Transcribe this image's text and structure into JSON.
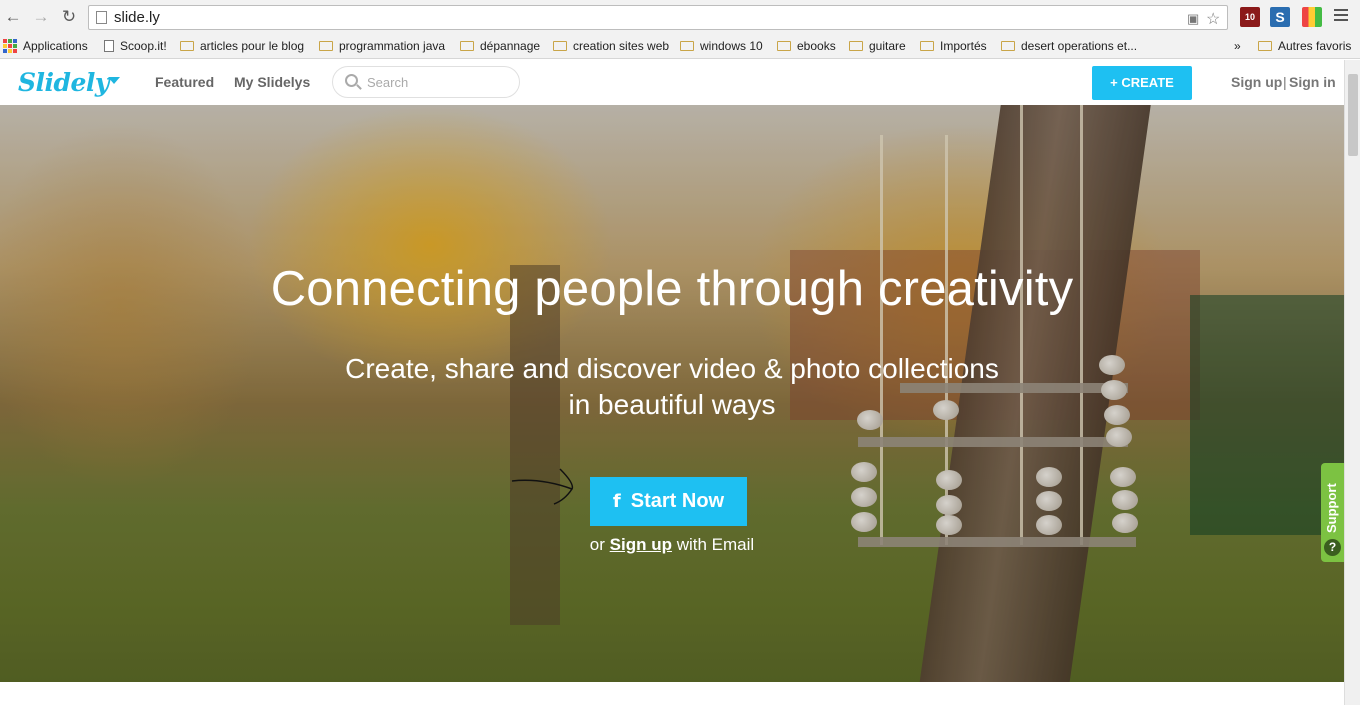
{
  "browser": {
    "url": "slide.ly",
    "bookmarks": [
      {
        "label": "Applications",
        "icon": "apps-grid-icon"
      },
      {
        "label": "Scoop.it!",
        "icon": "doc-icon"
      },
      {
        "label": "articles pour le blog",
        "icon": "folder-icon"
      },
      {
        "label": "programmation java",
        "icon": "folder-icon"
      },
      {
        "label": "dépannage",
        "icon": "folder-icon"
      },
      {
        "label": "creation sites web",
        "icon": "folder-icon"
      },
      {
        "label": "windows 10",
        "icon": "folder-icon"
      },
      {
        "label": "ebooks",
        "icon": "folder-icon"
      },
      {
        "label": "guitare",
        "icon": "folder-icon"
      },
      {
        "label": "Importés",
        "icon": "folder-icon"
      },
      {
        "label": "desert operations et...",
        "icon": "folder-icon"
      }
    ],
    "overflow_label": "»",
    "other_bookmarks": "Autres favoris",
    "ublock_count": "10"
  },
  "header": {
    "logo": "Slidely",
    "nav": {
      "featured": "Featured",
      "my_slidelys": "My Slidelys"
    },
    "search_placeholder": "Search",
    "create_label": "+ CREATE",
    "sign_up": "Sign up",
    "separator": "|",
    "sign_in": "Sign in"
  },
  "hero": {
    "headline": "Connecting people through creativity",
    "subline_1": "Create, share and discover video & photo collections",
    "subline_2": "in beautiful ways",
    "start_icon": "f",
    "start_label": "Start Now",
    "or_prefix": "or",
    "signup_link": "Sign up",
    "or_suffix": "with Email"
  },
  "support": {
    "label": "Support",
    "icon": "?"
  },
  "colors": {
    "accent": "#1ec0f2",
    "logo": "#1fb6e0",
    "support": "#7cc242"
  }
}
